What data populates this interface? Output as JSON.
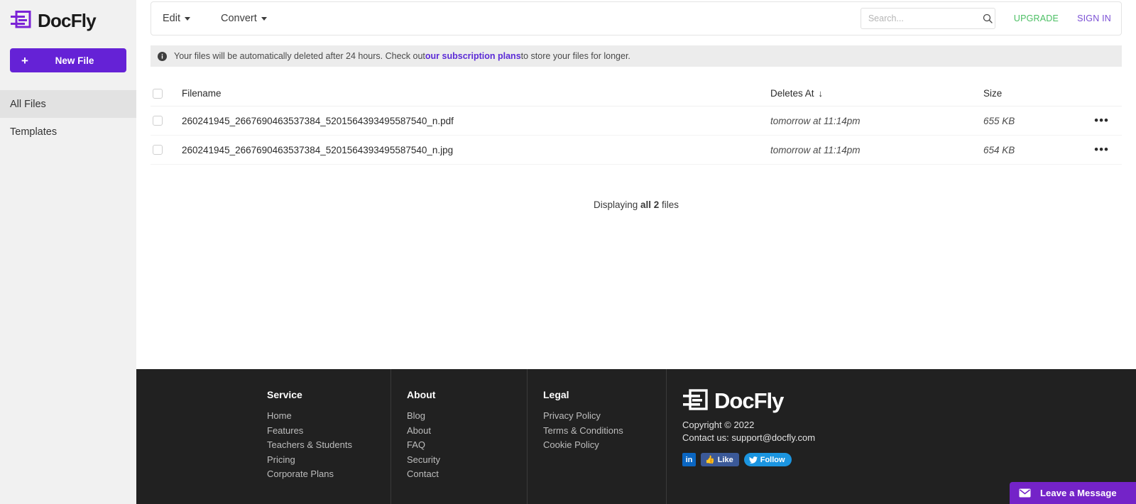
{
  "brand": {
    "name": "DocFly",
    "logo_icon": "docfly-logo-icon",
    "accent_purple": "#6522d6"
  },
  "sidebar": {
    "new_file": {
      "label": "New File",
      "icon": "plus-icon"
    },
    "items": [
      {
        "label": "All Files",
        "active": true
      },
      {
        "label": "Templates",
        "active": false
      }
    ]
  },
  "toolbar": {
    "menus": [
      {
        "label": "Edit",
        "icon": "chevron-down-icon"
      },
      {
        "label": "Convert",
        "icon": "chevron-down-icon"
      }
    ],
    "search": {
      "placeholder": "Search...",
      "value": "",
      "icon": "search-icon"
    },
    "upgrade_label": "UPGRADE",
    "upgrade_color": "#4bbf63",
    "signin_label": "SIGN IN",
    "signin_color": "#7a4fd4"
  },
  "banner": {
    "icon": "info-icon",
    "text_before": "Your files will be automatically deleted after 24 hours. Check out ",
    "link_text": "our subscription plans",
    "text_after": " to store your files for longer.",
    "link_color": "#5b2bd6"
  },
  "table": {
    "columns": {
      "filename": "Filename",
      "deletes_at": "Deletes At",
      "sort_indicator": "↓",
      "size": "Size"
    },
    "rows": [
      {
        "filename": "260241945_2667690463537384_5201564393495587540_n.pdf",
        "deletes_at": "tomorrow at 11:14pm",
        "size": "655 KB",
        "menu_icon": "ellipsis-icon"
      },
      {
        "filename": "260241945_2667690463537384_5201564393495587540_n.jpg",
        "deletes_at": "tomorrow at 11:14pm",
        "size": "654 KB",
        "menu_icon": "ellipsis-icon"
      }
    ],
    "summary": {
      "prefix": "Displaying ",
      "count": "all 2",
      "suffix": " files"
    }
  },
  "footer": {
    "columns": [
      {
        "heading": "Service",
        "links": [
          "Home",
          "Features",
          "Teachers & Students",
          "Pricing",
          "Corporate Plans"
        ]
      },
      {
        "heading": "About",
        "links": [
          "Blog",
          "About",
          "FAQ",
          "Security",
          "Contact"
        ]
      },
      {
        "heading": "Legal",
        "links": [
          "Privacy Policy",
          "Terms & Conditions",
          "Cookie Policy"
        ]
      }
    ],
    "brand_name": "DocFly",
    "copyright": "Copyright © 2022",
    "contact": "Contact us: support@docfly.com",
    "social": {
      "linkedin_label": "in",
      "facebook_label": "Like",
      "twitter_label": "Follow"
    }
  },
  "chat_widget": {
    "label": "Leave a Message",
    "icon": "envelope-icon",
    "color": "#7423c8"
  }
}
